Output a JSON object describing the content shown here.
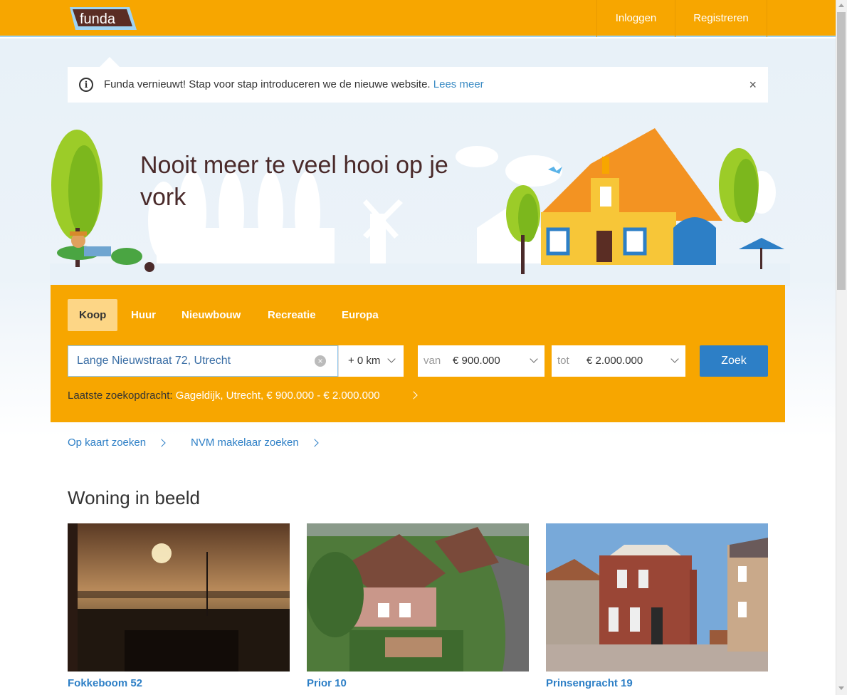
{
  "header": {
    "logo_text": "funda",
    "login_label": "Inloggen",
    "register_label": "Registreren"
  },
  "notice": {
    "text": "Funda vernieuwt! Stap voor stap introduceren we de nieuwe website.",
    "link": "Lees meer",
    "close": "×"
  },
  "hero": {
    "title": "Nooit meer te veel hooi op je vork"
  },
  "search": {
    "tabs": [
      "Koop",
      "Huur",
      "Nieuwbouw",
      "Recreatie",
      "Europa"
    ],
    "active_tab": "Koop",
    "location_value": "Lange Nieuwstraat 72, Utrecht",
    "radius": "+ 0 km",
    "price_from_label": "van",
    "price_from_value": "€ 900.000",
    "price_to_label": "tot",
    "price_to_value": "€ 2.000.000",
    "button": "Zoek",
    "last_search_label": "Laatste zoekopdracht:",
    "last_search_value": "Gageldijk, Utrecht, € 900.000 - € 2.000.000"
  },
  "links": {
    "map": "Op kaart zoeken",
    "nvm": "NVM makelaar zoeken"
  },
  "featured": {
    "title": "Woning in beeld",
    "cards": [
      {
        "title": "Fokkeboom 52"
      },
      {
        "title": "Prior 10"
      },
      {
        "title": "Prinsengracht 19"
      }
    ]
  },
  "colors": {
    "brand_orange": "#f7a600",
    "link_blue": "#2d7fc6",
    "button_blue": "#2d7fc6"
  }
}
